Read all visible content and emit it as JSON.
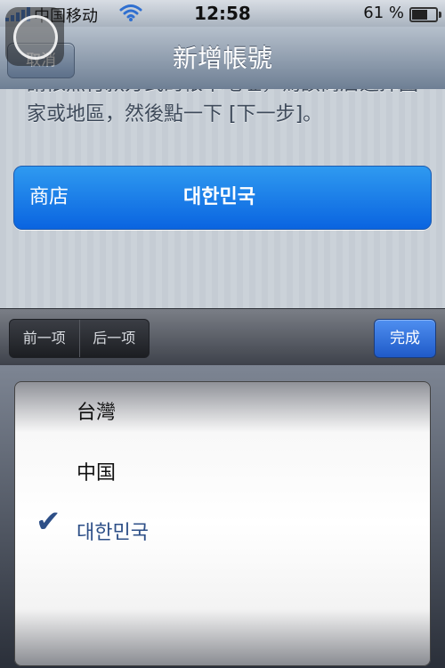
{
  "status_bar": {
    "carrier": "中国移动",
    "time": "12:58",
    "battery_percent": "61 %",
    "battery_level": 0.61,
    "icons": [
      "signal-icon",
      "wifi-icon",
      "battery-icon"
    ]
  },
  "nav": {
    "cancel_label": "取消",
    "title": "新增帳號"
  },
  "instructions": "請依照付款方式的帳單地址，為該商店選擇國家或地區，然後點一下 [下一步]。",
  "store": {
    "label": "商店",
    "value": "대한민국"
  },
  "toolbar": {
    "prev_label": "前一项",
    "next_label": "后一项",
    "done_label": "完成"
  },
  "picker": {
    "items": [
      "台灣",
      "中国",
      "대한민국"
    ],
    "selected_index": 2
  },
  "colors": {
    "accent_blue": "#0a64e0",
    "check_blue": "#2d4f87"
  }
}
